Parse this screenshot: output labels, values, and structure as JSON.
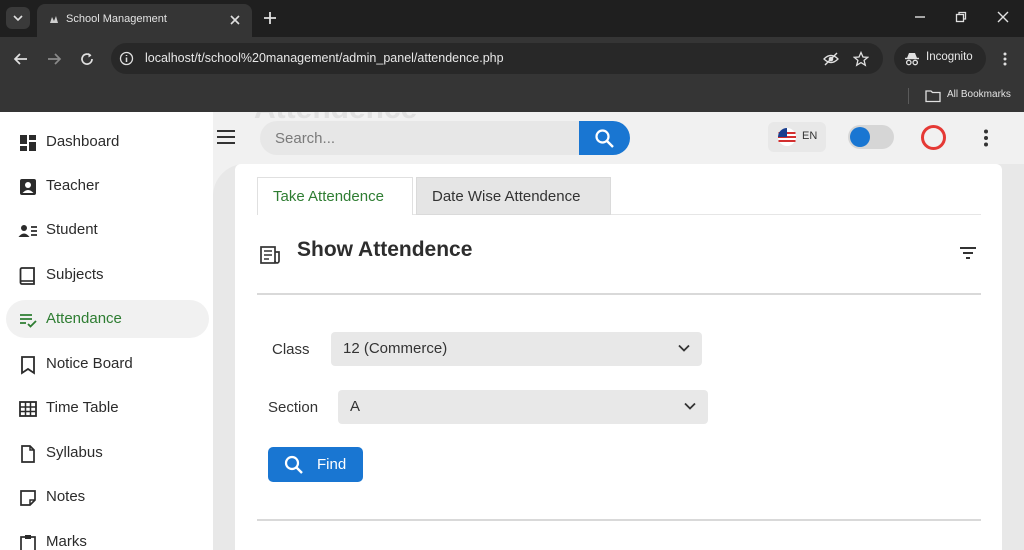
{
  "browser": {
    "tab_title": "School Management",
    "url": "localhost/t/school%20management/admin_panel/attendence.php",
    "incognito_label": "Incognito",
    "bookmarks_label": "All Bookmarks"
  },
  "page": {
    "ghost_title": "Attendence"
  },
  "sidebar": {
    "items": [
      {
        "label": "Dashboard",
        "icon": "dashboard-icon"
      },
      {
        "label": "Teacher",
        "icon": "teacher-icon"
      },
      {
        "label": "Student",
        "icon": "student-icon"
      },
      {
        "label": "Subjects",
        "icon": "book-icon"
      },
      {
        "label": "Attendance",
        "icon": "checklist-icon",
        "active": true
      },
      {
        "label": "Notice Board",
        "icon": "bookmark-icon"
      },
      {
        "label": "Time Table",
        "icon": "table-icon"
      },
      {
        "label": "Syllabus",
        "icon": "document-icon"
      },
      {
        "label": "Notes",
        "icon": "note-icon"
      },
      {
        "label": "Marks",
        "icon": "clipboard-icon"
      }
    ]
  },
  "header": {
    "search_placeholder": "Search...",
    "lang_label": "EN"
  },
  "content": {
    "tabs": [
      {
        "label": "Take Attendence",
        "active": true
      },
      {
        "label": "Date Wise Attendence",
        "active": false
      }
    ],
    "section_title": "Show Attendence",
    "class_label": "Class",
    "class_value": "12 (Commerce)",
    "section_label": "Section",
    "section_value": "A",
    "find_label": "Find"
  },
  "colors": {
    "accent": "#1976d2",
    "active_green": "#2e7d32",
    "ring_red": "#e53935"
  }
}
